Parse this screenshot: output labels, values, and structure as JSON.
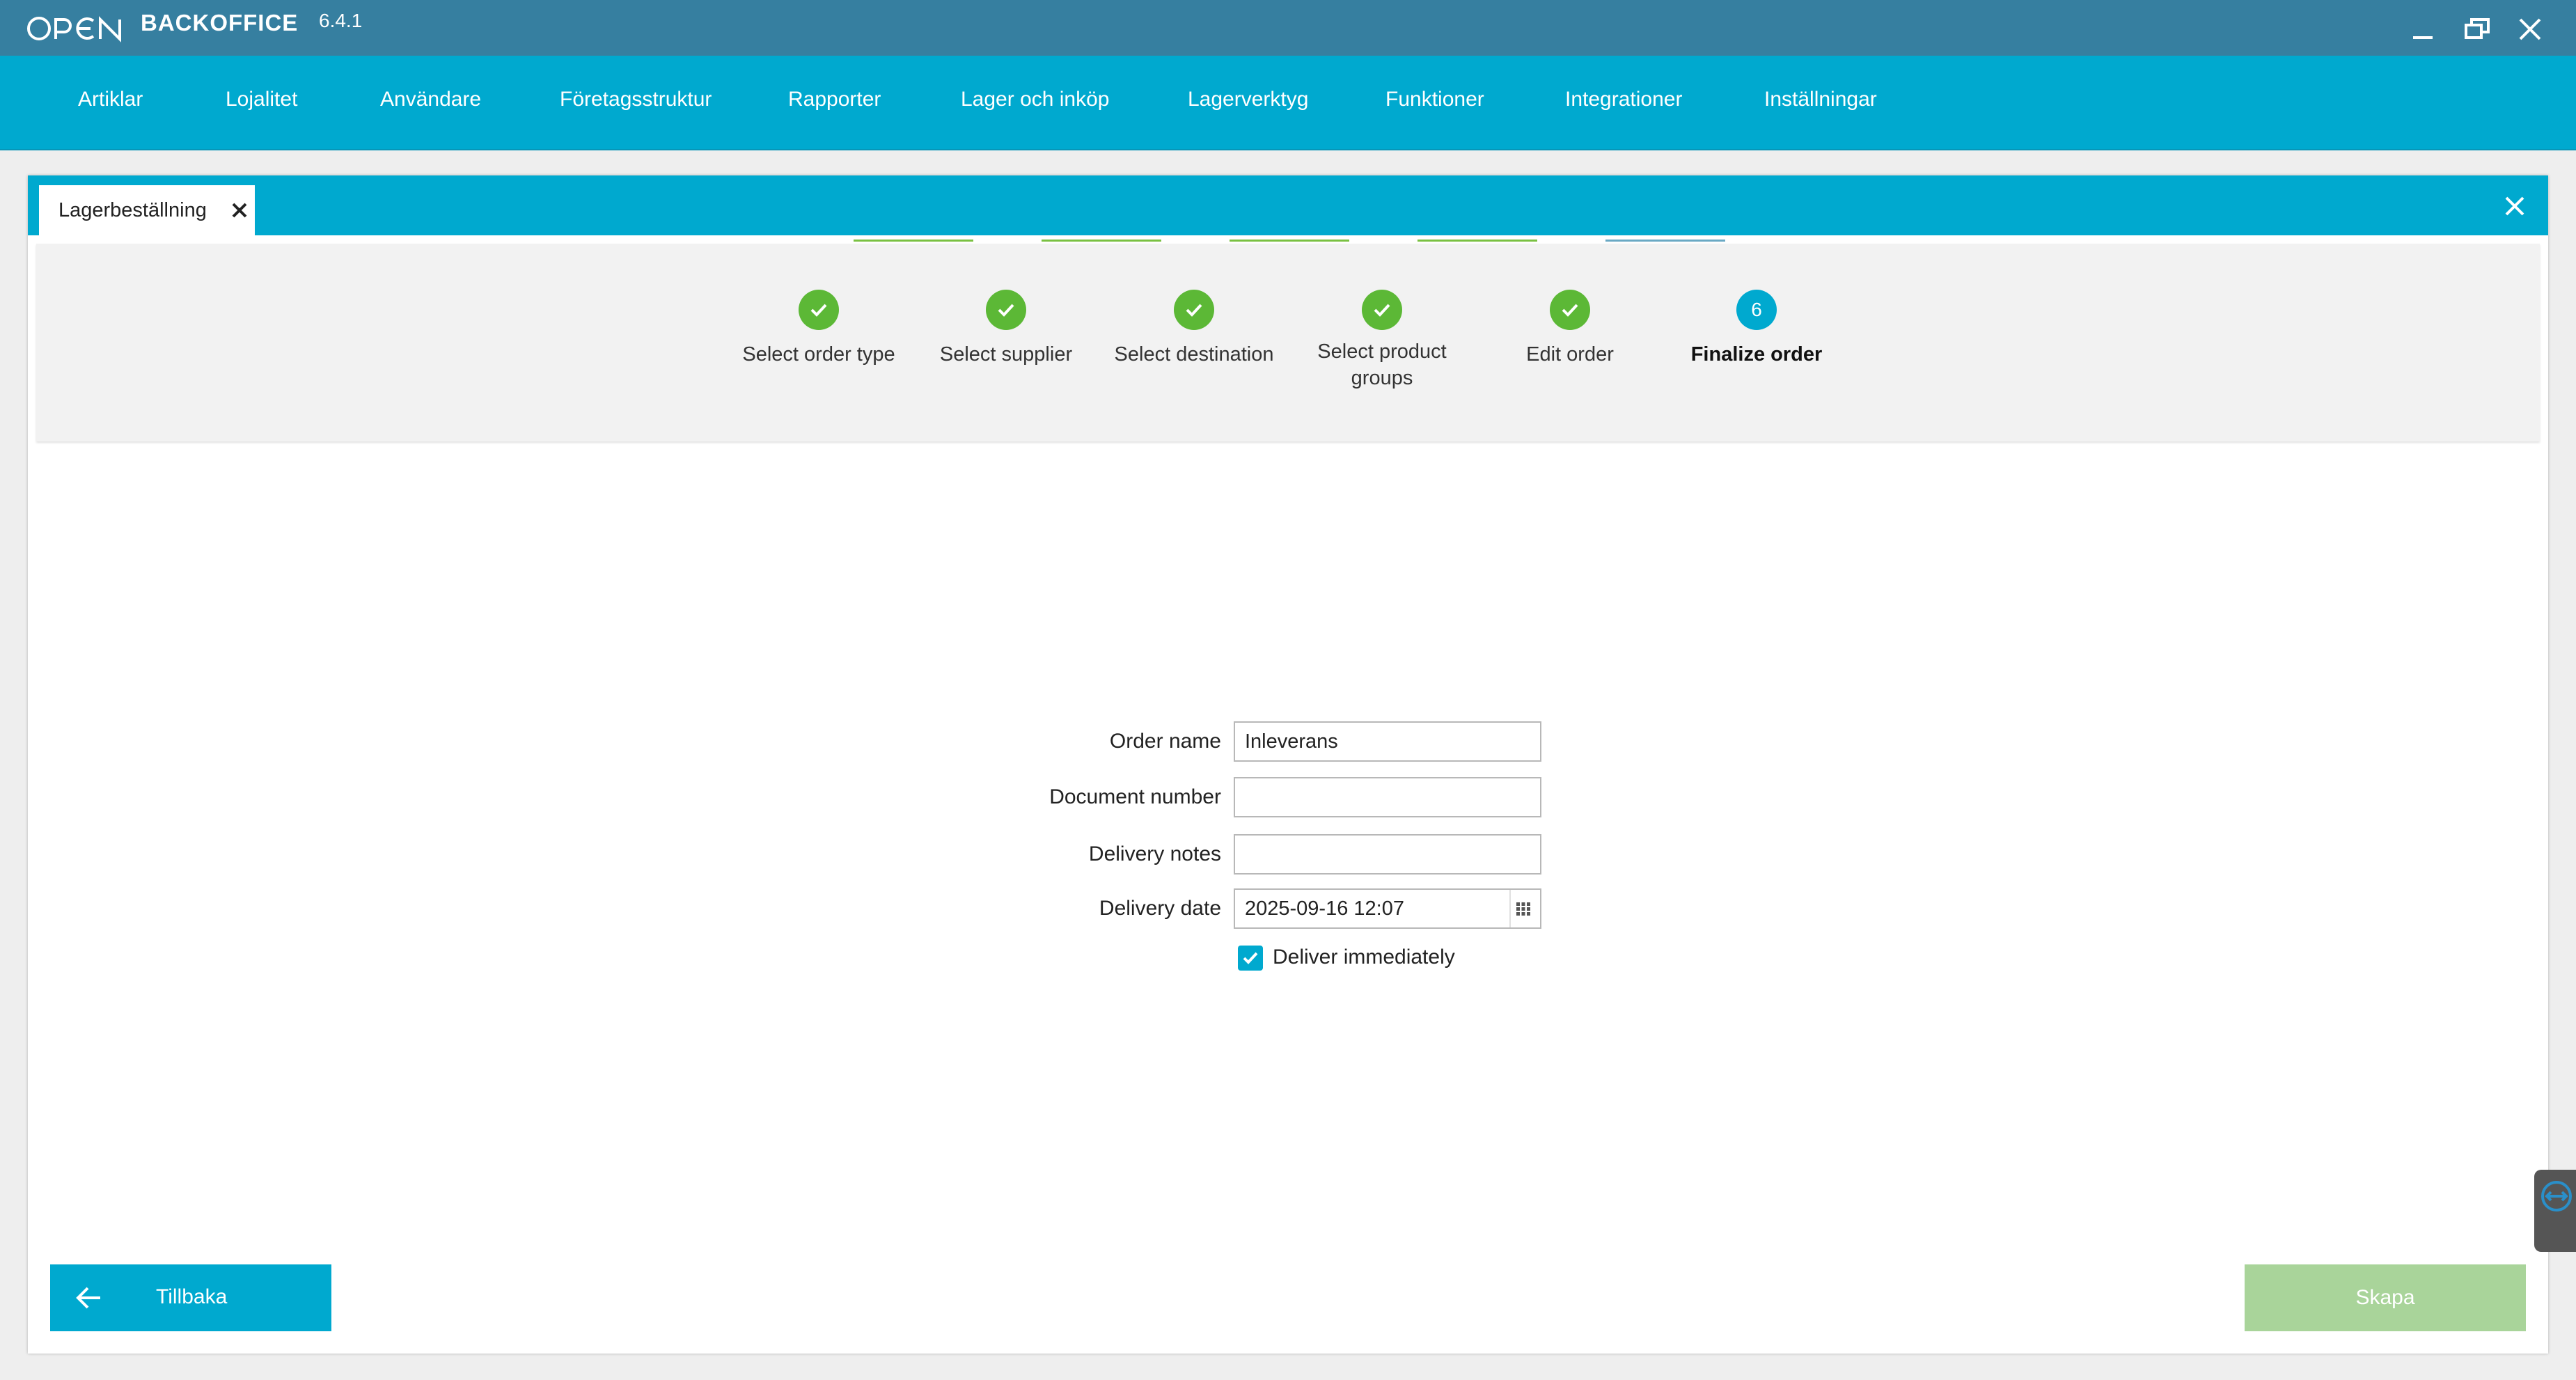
{
  "app": {
    "logo_text": "BACKOFFICE",
    "version": "6.4.1"
  },
  "window_controls": {
    "minimize": "minimize-icon",
    "restore": "restore-icon",
    "close": "close-icon"
  },
  "menu": {
    "items": [
      {
        "label": "Artiklar"
      },
      {
        "label": "Lojalitet"
      },
      {
        "label": "Användare"
      },
      {
        "label": "Företagsstruktur"
      },
      {
        "label": "Rapporter"
      },
      {
        "label": "Lager och inköp"
      },
      {
        "label": "Lagerverktyg"
      },
      {
        "label": "Funktioner"
      },
      {
        "label": "Integrationer"
      },
      {
        "label": "Inställningar"
      }
    ]
  },
  "tab": {
    "label": "Lagerbeställning"
  },
  "wizard": {
    "steps": [
      {
        "label": "Select order type",
        "status": "done"
      },
      {
        "label": "Select supplier",
        "status": "done"
      },
      {
        "label": "Select destination",
        "status": "done"
      },
      {
        "label": "Select product groups",
        "label_line1": "Select product",
        "label_line2": "groups",
        "status": "done"
      },
      {
        "label": "Edit order",
        "status": "done"
      },
      {
        "label": "Finalize order",
        "number": "6",
        "status": "active"
      }
    ]
  },
  "form": {
    "order_name": {
      "label": "Order name",
      "value": "Inleverans"
    },
    "document_number": {
      "label": "Document number",
      "value": ""
    },
    "delivery_notes": {
      "label": "Delivery notes",
      "value": ""
    },
    "delivery_date": {
      "label": "Delivery date",
      "value": "2025-09-16 12:07"
    },
    "deliver_immediately": {
      "label": "Deliver immediately",
      "checked": true
    }
  },
  "buttons": {
    "back_label": "Tillbaka",
    "create_label": "Skapa"
  },
  "colors": {
    "titlebar": "#367fa0",
    "accent": "#00a9cf",
    "step_done": "#5cb836",
    "create_disabled": "#a9d49a"
  }
}
